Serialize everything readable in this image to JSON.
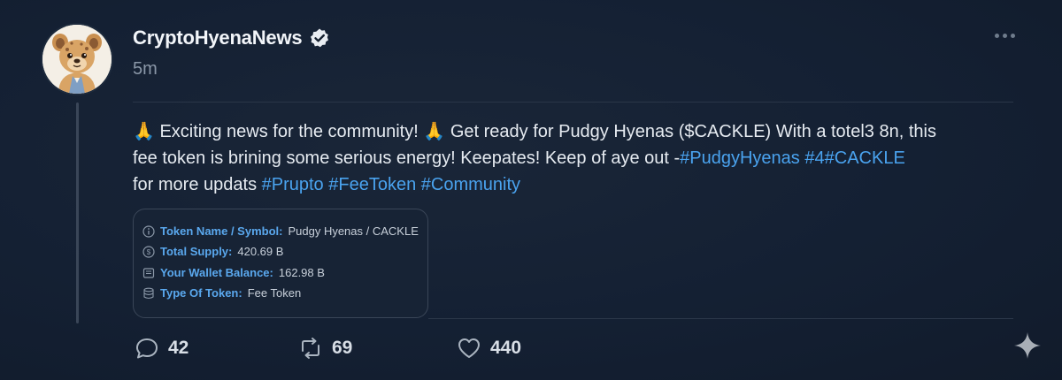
{
  "post": {
    "display_name": "CryptoHyenaNews",
    "timestamp": "5m",
    "body": {
      "line1": {
        "emoji1": "🙏",
        "text1": " Exciting news for the community! ",
        "emoji2": "🙏",
        "text2": " Get ready for Pudgy Hyenas ($CACKLE) With a totel3 8n, this"
      },
      "line2": {
        "text": "fee token is brining some serious energy! Keepates! Keep of aye out -",
        "hashtag1": "#PudgyHyenas",
        "hashtag2": " #4",
        "hashtag3": "#CACKLE"
      },
      "line3": {
        "text": "for more updats ",
        "hashtag1": "#Prupto",
        "hashtag2": " #FeeToken",
        "hashtag3": " #Community"
      }
    }
  },
  "token_card": {
    "rows": [
      {
        "icon": "info-icon",
        "label": "Token Name / Symbol:",
        "value": "Pudgy Hyenas / CACKLE"
      },
      {
        "icon": "coin-icon",
        "label": "Total Supply:",
        "value": "420.69 B"
      },
      {
        "icon": "wallet-icon",
        "label": "Your Wallet Balance:",
        "value": "162.98 B"
      },
      {
        "icon": "database-icon",
        "label": "Type Of Token:",
        "value": "Fee Token"
      }
    ]
  },
  "actions": {
    "replies": "42",
    "reposts": "69",
    "likes": "440"
  },
  "colors": {
    "background": "#15202f",
    "accent": "#4aa3ef",
    "muted": "#8b98a8"
  }
}
